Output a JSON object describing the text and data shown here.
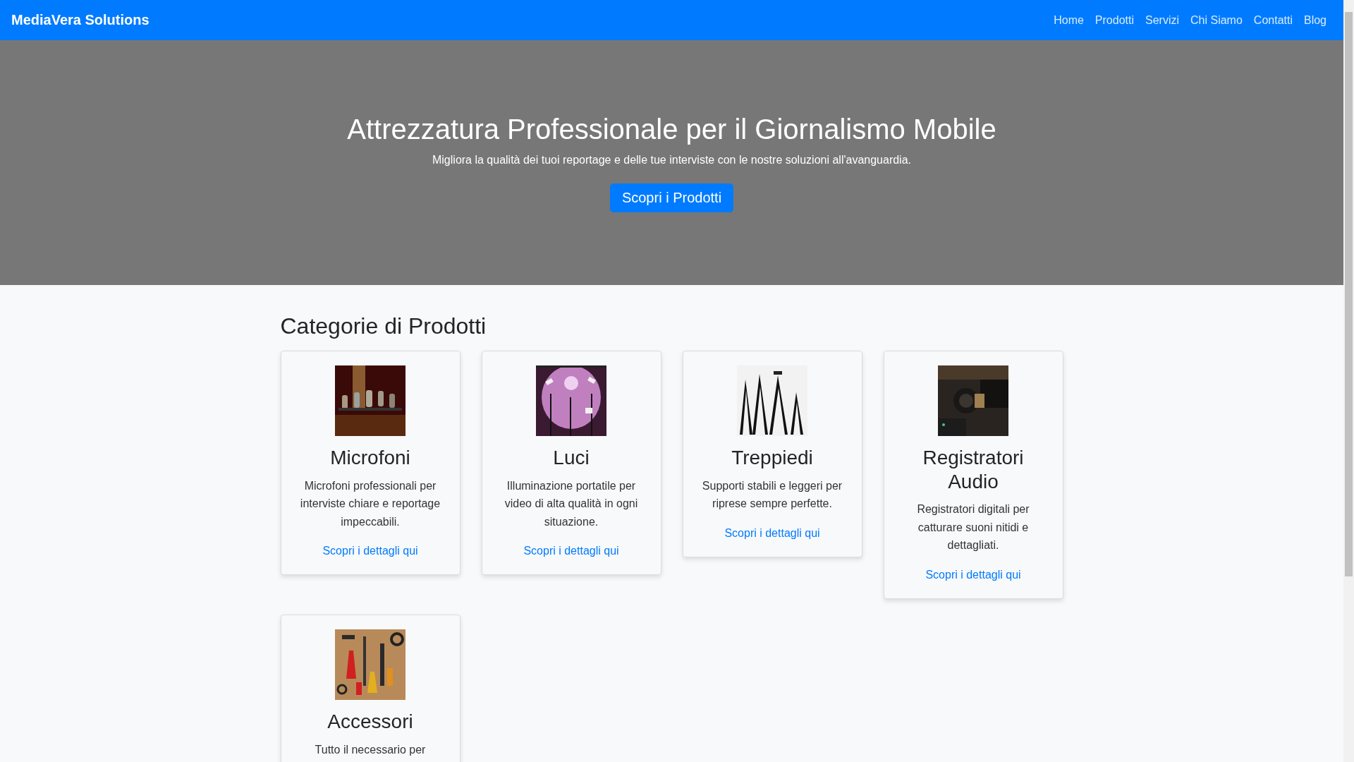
{
  "navbar": {
    "brand": "MediaVera Solutions",
    "links": [
      "Home",
      "Prodotti",
      "Servizi",
      "Chi Siamo",
      "Contatti",
      "Blog"
    ]
  },
  "hero": {
    "title": "Attrezzatura Professionale per il Giornalismo Mobile",
    "subtitle": "Migliora la qualità dei tuoi reportage e delle tue interviste con le nostre soluzioni all'avanguardia.",
    "button": "Scopri i Prodotti"
  },
  "section": {
    "title": "Categorie di Prodotti",
    "cards": [
      {
        "title": "Microfoni",
        "text": "Microfoni professionali per interviste chiare e reportage impeccabili.",
        "link": "Scopri i dettagli qui"
      },
      {
        "title": "Luci",
        "text": "Illuminazione portatile per video di alta qualità in ogni situazione.",
        "link": "Scopri i dettagli qui"
      },
      {
        "title": "Treppiedi",
        "text": "Supporti stabili e leggeri per riprese sempre perfette.",
        "link": "Scopri i dettagli qui"
      },
      {
        "title": "Registratori Audio",
        "text": "Registratori digitali per catturare suoni nitidi e dettagliati.",
        "link": "Scopri i dettagli qui"
      },
      {
        "title": "Accessori",
        "text": "Tutto il necessario per"
      }
    ]
  }
}
